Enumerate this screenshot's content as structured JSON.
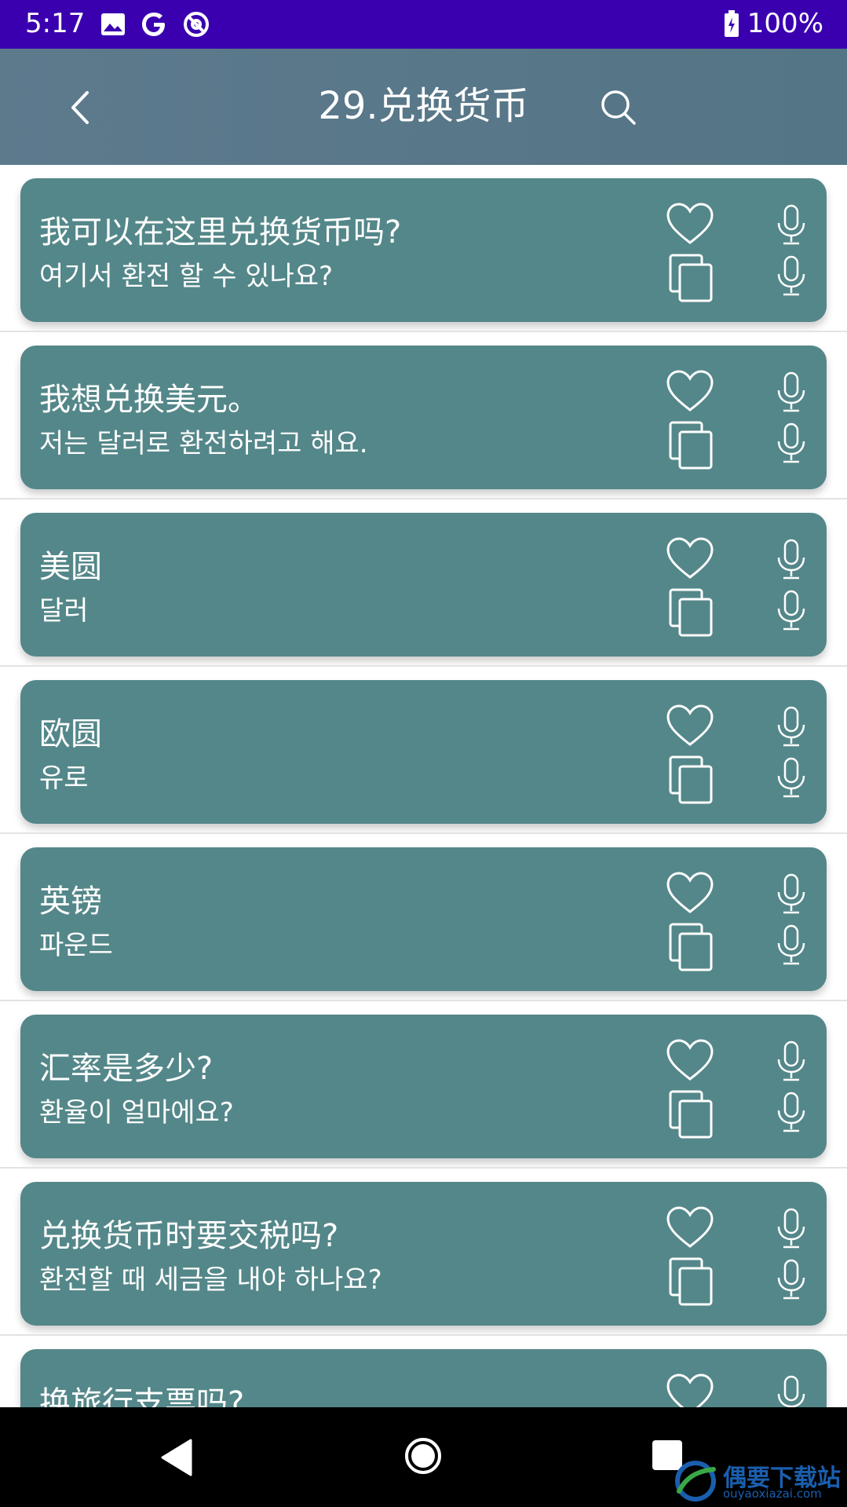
{
  "status_bar": {
    "time": "5:17",
    "battery": "100%"
  },
  "toolbar": {
    "title": "29.兑换货币"
  },
  "phrases": [
    {
      "zh": "我可以在这里兑换货币吗?",
      "ko": "여기서 환전 할 수 있나요?"
    },
    {
      "zh": "我想兑换美元。",
      "ko": "저는 달러로 환전하려고 해요."
    },
    {
      "zh": "美圆",
      "ko": "달러"
    },
    {
      "zh": "欧圆",
      "ko": "유로"
    },
    {
      "zh": "英镑",
      "ko": "파운드"
    },
    {
      "zh": "汇率是多少?",
      "ko": "환율이 얼마에요?"
    },
    {
      "zh": "兑换货币时要交税吗?",
      "ko": "환전할 때 세금을 내야 하나요?"
    },
    {
      "zh": "换旅行支票吗?",
      "ko": ""
    }
  ],
  "watermark": {
    "name": "偶要下载站",
    "url": "ouyaoxiazai.com"
  },
  "colors": {
    "status_bar": "#3a00b0",
    "toolbar": "#5a7888",
    "card": "#548789",
    "text": "#ffffff"
  },
  "icons": {
    "back": "chevron-left-icon",
    "search": "search-icon",
    "favorite": "heart-icon",
    "copy": "copy-icon",
    "speak": "mic-icon"
  }
}
